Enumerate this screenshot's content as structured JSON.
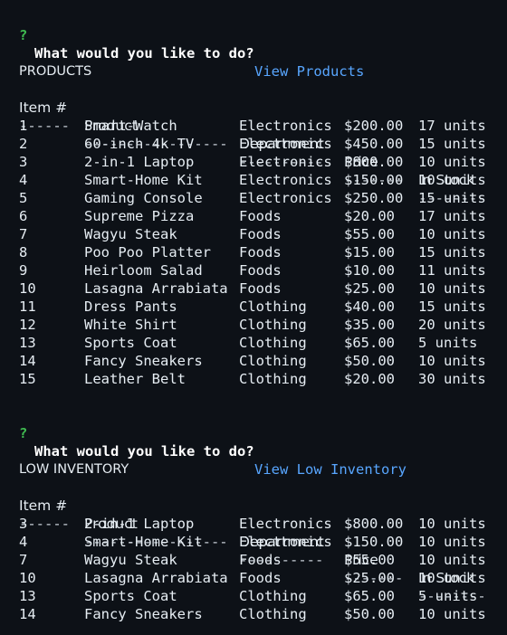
{
  "prompts": [
    {
      "mark": "?",
      "question": "What would you like to do?",
      "answer": "View Products"
    },
    {
      "mark": "?",
      "question": "What would you like to do?",
      "answer": "View Low Inventory"
    }
  ],
  "tables": [
    {
      "title": "PRODUCTS",
      "rule": "------------------------------------------------------------------",
      "headers": {
        "item": "Item #",
        "product": "Product",
        "department": "Department",
        "price": "Price",
        "stock": "In Stock"
      },
      "underlines": {
        "item": "------",
        "product": "-----------------",
        "department": "----------",
        "price": "-------",
        "stock": "--------"
      },
      "rows": [
        {
          "item": "1",
          "product": "Smart-Watch",
          "department": "Electronics",
          "price": "$200.00",
          "stock": "17 units"
        },
        {
          "item": "2",
          "product": "60-inch 4k TV",
          "department": "Electronics",
          "price": "$450.00",
          "stock": "15 units"
        },
        {
          "item": "3",
          "product": "2-in-1 Laptop",
          "department": "Electronics",
          "price": "$800.00",
          "stock": "10 units"
        },
        {
          "item": "4",
          "product": "Smart-Home Kit",
          "department": "Electronics",
          "price": "$150.00",
          "stock": "10 units"
        },
        {
          "item": "5",
          "product": "Gaming Console",
          "department": "Electronics",
          "price": "$250.00",
          "stock": "15 units"
        },
        {
          "item": "6",
          "product": "Supreme Pizza",
          "department": "Foods",
          "price": "$20.00",
          "stock": "17 units"
        },
        {
          "item": "7",
          "product": "Wagyu Steak",
          "department": "Foods",
          "price": "$55.00",
          "stock": "10 units"
        },
        {
          "item": "8",
          "product": "Poo Poo Platter",
          "department": "Foods",
          "price": "$15.00",
          "stock": "15 units"
        },
        {
          "item": "9",
          "product": "Heirloom Salad",
          "department": "Foods",
          "price": "$10.00",
          "stock": "11 units"
        },
        {
          "item": "10",
          "product": "Lasagna Arrabiata",
          "department": "Foods",
          "price": "$25.00",
          "stock": "10 units"
        },
        {
          "item": "11",
          "product": "Dress Pants",
          "department": "Clothing",
          "price": "$40.00",
          "stock": "15 units"
        },
        {
          "item": "12",
          "product": "White Shirt",
          "department": "Clothing",
          "price": "$35.00",
          "stock": "20 units"
        },
        {
          "item": "13",
          "product": "Sports Coat",
          "department": "Clothing",
          "price": "$65.00",
          "stock": "5 units"
        },
        {
          "item": "14",
          "product": "Fancy Sneakers",
          "department": "Clothing",
          "price": "$50.00",
          "stock": "10 units"
        },
        {
          "item": "15",
          "product": "Leather Belt",
          "department": "Clothing",
          "price": "$20.00",
          "stock": "30 units"
        }
      ]
    },
    {
      "title": "LOW INVENTORY",
      "rule": "------------------------------------------------------------------",
      "headers": {
        "item": "Item #",
        "product": "Product",
        "department": "Department",
        "price": "Price",
        "stock": "In Stock"
      },
      "underlines": {
        "item": "------",
        "product": "-----------------",
        "department": "----------",
        "price": "-------",
        "stock": "--------"
      },
      "rows": [
        {
          "item": "3",
          "product": "2-in-1 Laptop",
          "department": "Electronics",
          "price": "$800.00",
          "stock": "10 units"
        },
        {
          "item": "4",
          "product": "Smart-Home Kit",
          "department": "Electronics",
          "price": "$150.00",
          "stock": "10 units"
        },
        {
          "item": "7",
          "product": "Wagyu Steak",
          "department": "Foods",
          "price": "$55.00",
          "stock": "10 units"
        },
        {
          "item": "10",
          "product": "Lasagna Arrabiata",
          "department": "Foods",
          "price": "$25.00",
          "stock": "10 units"
        },
        {
          "item": "13",
          "product": "Sports Coat",
          "department": "Clothing",
          "price": "$65.00",
          "stock": "5 units"
        },
        {
          "item": "14",
          "product": "Fancy Sneakers",
          "department": "Clothing",
          "price": "$50.00",
          "stock": "10 units"
        }
      ]
    }
  ],
  "colors": {
    "background": "#0d1117",
    "prompt_mark": "#3fb950",
    "answer": "#58a6ff",
    "text": "#e6edf3"
  }
}
